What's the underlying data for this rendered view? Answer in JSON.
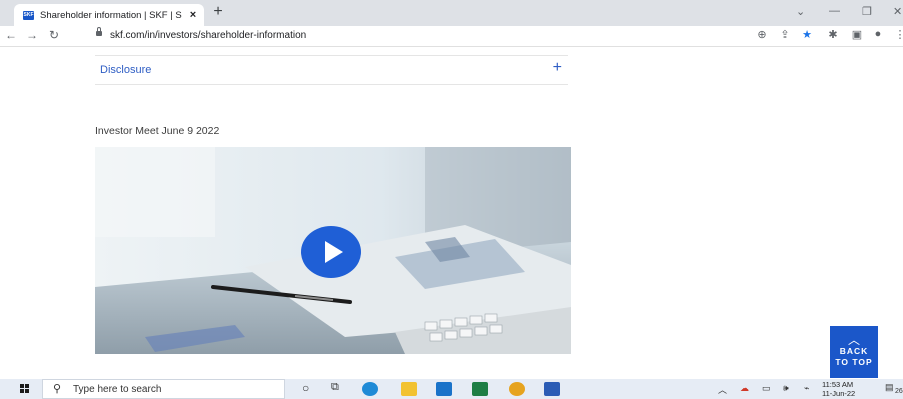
{
  "browser": {
    "tab_title": "Shareholder information | SKF | S",
    "favicon_text": "SKF",
    "close_glyph": "×",
    "new_tab_glyph": "+",
    "url": "skf.com/in/investors/shareholder-information"
  },
  "page": {
    "accordion": {
      "label": "Disclosure",
      "toggle": "+"
    },
    "video_title": "Investor Meet June 9 2022",
    "back_to_top": {
      "line1": "BACK",
      "line2": "TO TOP"
    }
  },
  "taskbar": {
    "search_placeholder": "Type here to search",
    "time": "11:53 AM",
    "date": "11-Jun-22",
    "notification_count": "26"
  },
  "colors": {
    "accent": "#1b57c9",
    "link": "#2f5ec4",
    "play": "#1f5fd6"
  }
}
